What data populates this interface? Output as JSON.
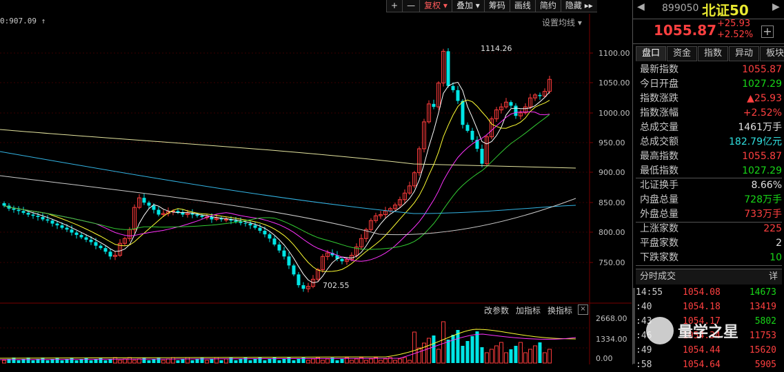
{
  "toolbar": {
    "items": [
      "+",
      "—",
      "复权",
      "叠加",
      "筹码",
      "画线",
      "简约",
      "隐藏"
    ],
    "fuquan_arrow": "▾",
    "diejia_arrow": "▾",
    "hide_arrows": "▸▸"
  },
  "info_line": "0:907.09 ↑",
  "ma_setting": "设置均线 ▾",
  "price_axis": [
    "1100.00",
    "1050.00",
    "1000.00",
    "950.00",
    "900.00",
    "850.00",
    "800.00",
    "750.00"
  ],
  "annotations": {
    "high": "1114.26",
    "low": "702.55"
  },
  "volume": {
    "tools": [
      "改参数",
      "加指标",
      "换指标"
    ],
    "close": "×",
    "axis": [
      "2668.00",
      "1334.00",
      "0.00"
    ]
  },
  "quote": {
    "code": "899050",
    "name": "北证50",
    "price": "1055.87",
    "change": "+25.93",
    "change_pct": "+2.52%",
    "add": "+"
  },
  "tabs": [
    "盘口",
    "资金",
    "指数",
    "异动",
    "板块"
  ],
  "stats": [
    {
      "label": "最新指数",
      "value": "1055.87",
      "color": "red"
    },
    {
      "label": "今日开盘",
      "value": "1027.29",
      "color": "grn"
    },
    {
      "label": "指数涨跌",
      "value": "▲25.93",
      "color": "red"
    },
    {
      "label": "指数涨幅",
      "value": "+2.52%",
      "color": "red"
    },
    {
      "label": "总成交量",
      "value": "1461万手",
      "color": "wht"
    },
    {
      "label": "总成交额",
      "value": "182.79亿元",
      "color": "cyan"
    },
    {
      "label": "最高指数",
      "value": "1055.87",
      "color": "red"
    },
    {
      "label": "最低指数",
      "value": "1027.29",
      "color": "grn"
    },
    {
      "label": "北证换手",
      "value": "8.66%",
      "color": "wht"
    },
    {
      "label": "内盘总量",
      "value": "728万手",
      "color": "grn"
    },
    {
      "label": "外盘总量",
      "value": "733万手",
      "color": "red"
    },
    {
      "label": "上涨家数",
      "value": "225",
      "color": "red"
    },
    {
      "label": "平盘家数",
      "value": "2",
      "color": "wht"
    },
    {
      "label": "下跌家数",
      "value": "10",
      "color": "grn"
    }
  ],
  "ticks": {
    "title": "分时成交",
    "detail": "详",
    "rows": [
      {
        "time": "14:55",
        "price": "1054.08",
        "vol": "14673",
        "color": "grn"
      },
      {
        "time": ":40",
        "price": "1054.18",
        "vol": "13419",
        "color": "red"
      },
      {
        "time": ":43",
        "price": "1054.17",
        "vol": "5802",
        "color": "grn"
      },
      {
        "time": ":46",
        "price": "1054.34",
        "vol": "11753",
        "color": "red"
      },
      {
        "time": ":49",
        "price": "1054.44",
        "vol": "15620",
        "color": "red"
      },
      {
        "time": ":58",
        "price": "1054.64",
        "vol": "5905",
        "color": "red"
      }
    ]
  },
  "watermark": "量学之星"
}
